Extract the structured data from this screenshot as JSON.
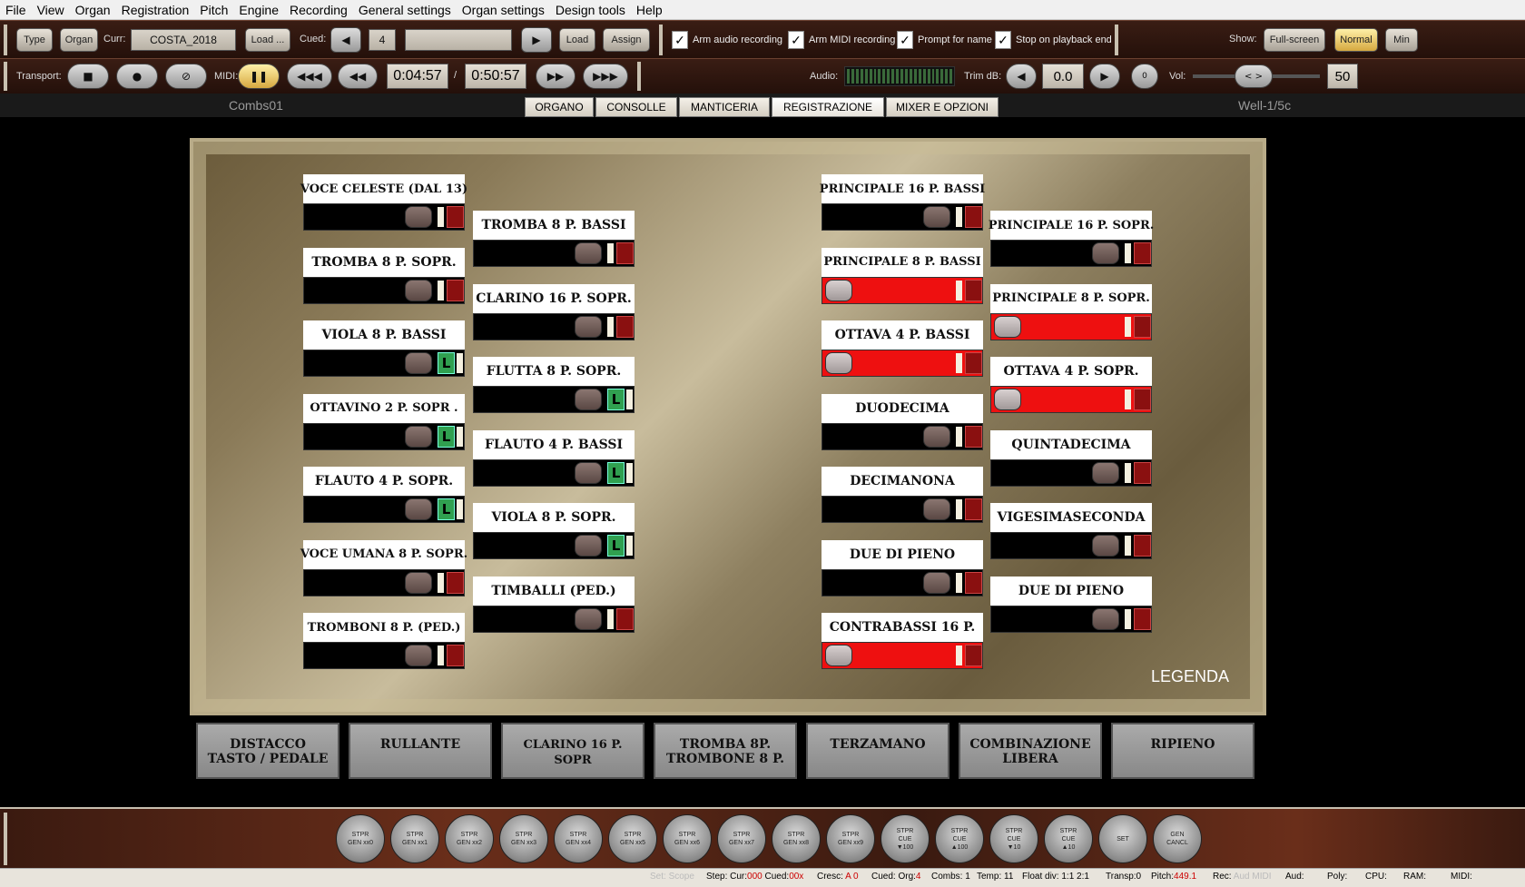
{
  "menu": [
    "File",
    "View",
    "Organ",
    "Registration",
    "Pitch",
    "Engine",
    "Recording",
    "General settings",
    "Organ settings",
    "Design tools",
    "Help"
  ],
  "toolbar1": {
    "type": "Type",
    "organ": "Organ",
    "curr_label": "Curr:",
    "curr_value": "COSTA_2018",
    "load_dots": "Load ...",
    "cued_label": "Cued:",
    "cued_value": "4",
    "load": "Load",
    "assign": "Assign",
    "arm_audio": "Arm audio recording",
    "arm_midi": "Arm MIDI recording",
    "prompt_name": "Prompt for name",
    "stop_playback": "Stop on playback end",
    "show_label": "Show:",
    "fullscreen": "Full-screen",
    "normal": "Normal",
    "min": "Min",
    "check": "✓"
  },
  "toolbar2": {
    "transport_label": "Transport:",
    "midi_label": "MIDI:",
    "time_cur": "0:04:57",
    "slash": "/",
    "time_total": "0:50:57",
    "audio_label": "Audio:",
    "trim_label": "Trim dB:",
    "trim_value": "0.0",
    "zero": "0",
    "vol_label": "Vol:",
    "vol_value": "50"
  },
  "tabs": {
    "left": "Combs01",
    "right": "Well-1/5c",
    "items": [
      "ORGANO",
      "CONSOLLE",
      "MANTICERIA",
      "REGISTRAZIONE",
      "MIXER E OPZIONI"
    ]
  },
  "stops": [
    {
      "name": "VOCE CELESTE (DAL 13)",
      "on": false,
      "lock": false
    },
    {
      "name": "TROMBA 8 P. SOPR.",
      "on": false,
      "lock": false
    },
    {
      "name": "VIOLA 8 P. BASSI",
      "on": false,
      "lock": true
    },
    {
      "name": "OTTAVINO 2 P. SOPR .",
      "on": false,
      "lock": true
    },
    {
      "name": "FLAUTO 4 P. SOPR.",
      "on": false,
      "lock": true
    },
    {
      "name": "VOCE UMANA 8 P. SOPR.",
      "on": false,
      "lock": false
    },
    {
      "name": "TROMBONI 8 P. (PED.)",
      "on": false,
      "lock": false
    },
    {
      "name": "TROMBA 8 P. BASSI",
      "on": false,
      "lock": false
    },
    {
      "name": "CLARINO 16 P. SOPR.",
      "on": false,
      "lock": false
    },
    {
      "name": "FLUTTA 8 P. SOPR.",
      "on": false,
      "lock": true
    },
    {
      "name": "FLAUTO 4 P. BASSI",
      "on": false,
      "lock": true
    },
    {
      "name": "VIOLA 8 P. SOPR.",
      "on": false,
      "lock": true
    },
    {
      "name": "TIMBALLI (PED.)",
      "on": false,
      "lock": false
    },
    {
      "name": "PRINCIPALE 16 P. BASSI",
      "on": false,
      "lock": false
    },
    {
      "name": "PRINCIPALE 8 P. BASSI",
      "on": true,
      "lock": false
    },
    {
      "name": "OTTAVA  4 P. BASSI",
      "on": true,
      "lock": false
    },
    {
      "name": "DUODECIMA",
      "on": false,
      "lock": false
    },
    {
      "name": "DECIMANONA",
      "on": false,
      "lock": false
    },
    {
      "name": "DUE DI PIENO",
      "on": false,
      "lock": false
    },
    {
      "name": "CONTRABASSI 16 P.",
      "on": true,
      "lock": false
    },
    {
      "name": "PRINCIPALE 16 P. SOPR.",
      "on": false,
      "lock": false
    },
    {
      "name": "PRINCIPALE 8 P. SOPR.",
      "on": true,
      "lock": false
    },
    {
      "name": "OTTAVA 4 P. SOPR.",
      "on": true,
      "lock": false
    },
    {
      "name": "QUINTADECIMA",
      "on": false,
      "lock": false
    },
    {
      "name": "VIGESIMASECONDA",
      "on": false,
      "lock": false
    },
    {
      "name": "DUE DI PIENO",
      "on": false,
      "lock": false
    }
  ],
  "lock_glyph": "L",
  "legend": "LEGENDA",
  "pistons": [
    "DISTACCO\nTASTO / PEDALE",
    "RULLANTE",
    "CLARINO 16 P. SOPR",
    "TROMBA 8P.\nTROMBONE 8 P.",
    "TERZAMANO",
    "COMBINAZIONE\nLIBERA",
    "RIPIENO"
  ],
  "round_buttons": [
    "STPR\nGEN xx0",
    "STPR\nGEN xx1",
    "STPR\nGEN xx2",
    "STPR\nGEN xx3",
    "STPR\nGEN xx4",
    "STPR\nGEN xx5",
    "STPR\nGEN xx6",
    "STPR\nGEN xx7",
    "STPR\nGEN xx8",
    "STPR\nGEN xx9",
    "STPR\nCUE\n▼100",
    "STPR\nCUE\n▲100",
    "STPR\nCUE\n▼10",
    "STPR\nCUE\n▲10",
    "SET",
    "GEN\nCANCL"
  ],
  "status": {
    "set_scope": "Set: Scope",
    "step": "Step: Cur:",
    "step_cur": "000",
    "cued": " Cued:",
    "cued_val": "00x",
    "cresc": "Cresc:",
    "cresc_val": "A 0",
    "cued_org": "Cued: Org:",
    "cued_org_val": "4",
    "combs": "Combs:",
    "combs_val": "1",
    "temp": "Temp:",
    "temp_val": "11",
    "float": "Float div: 1:1 2:1",
    "transp": "Transp:",
    "transp_val": "0",
    "pitch": "Pitch:",
    "pitch_val": "449.1",
    "rec": "Rec:",
    "rec_val": "Aud MIDI",
    "aud": "Aud:",
    "poly": "Poly:",
    "cpu": "CPU:",
    "ram": "RAM:",
    "midi": "MIDI:"
  }
}
